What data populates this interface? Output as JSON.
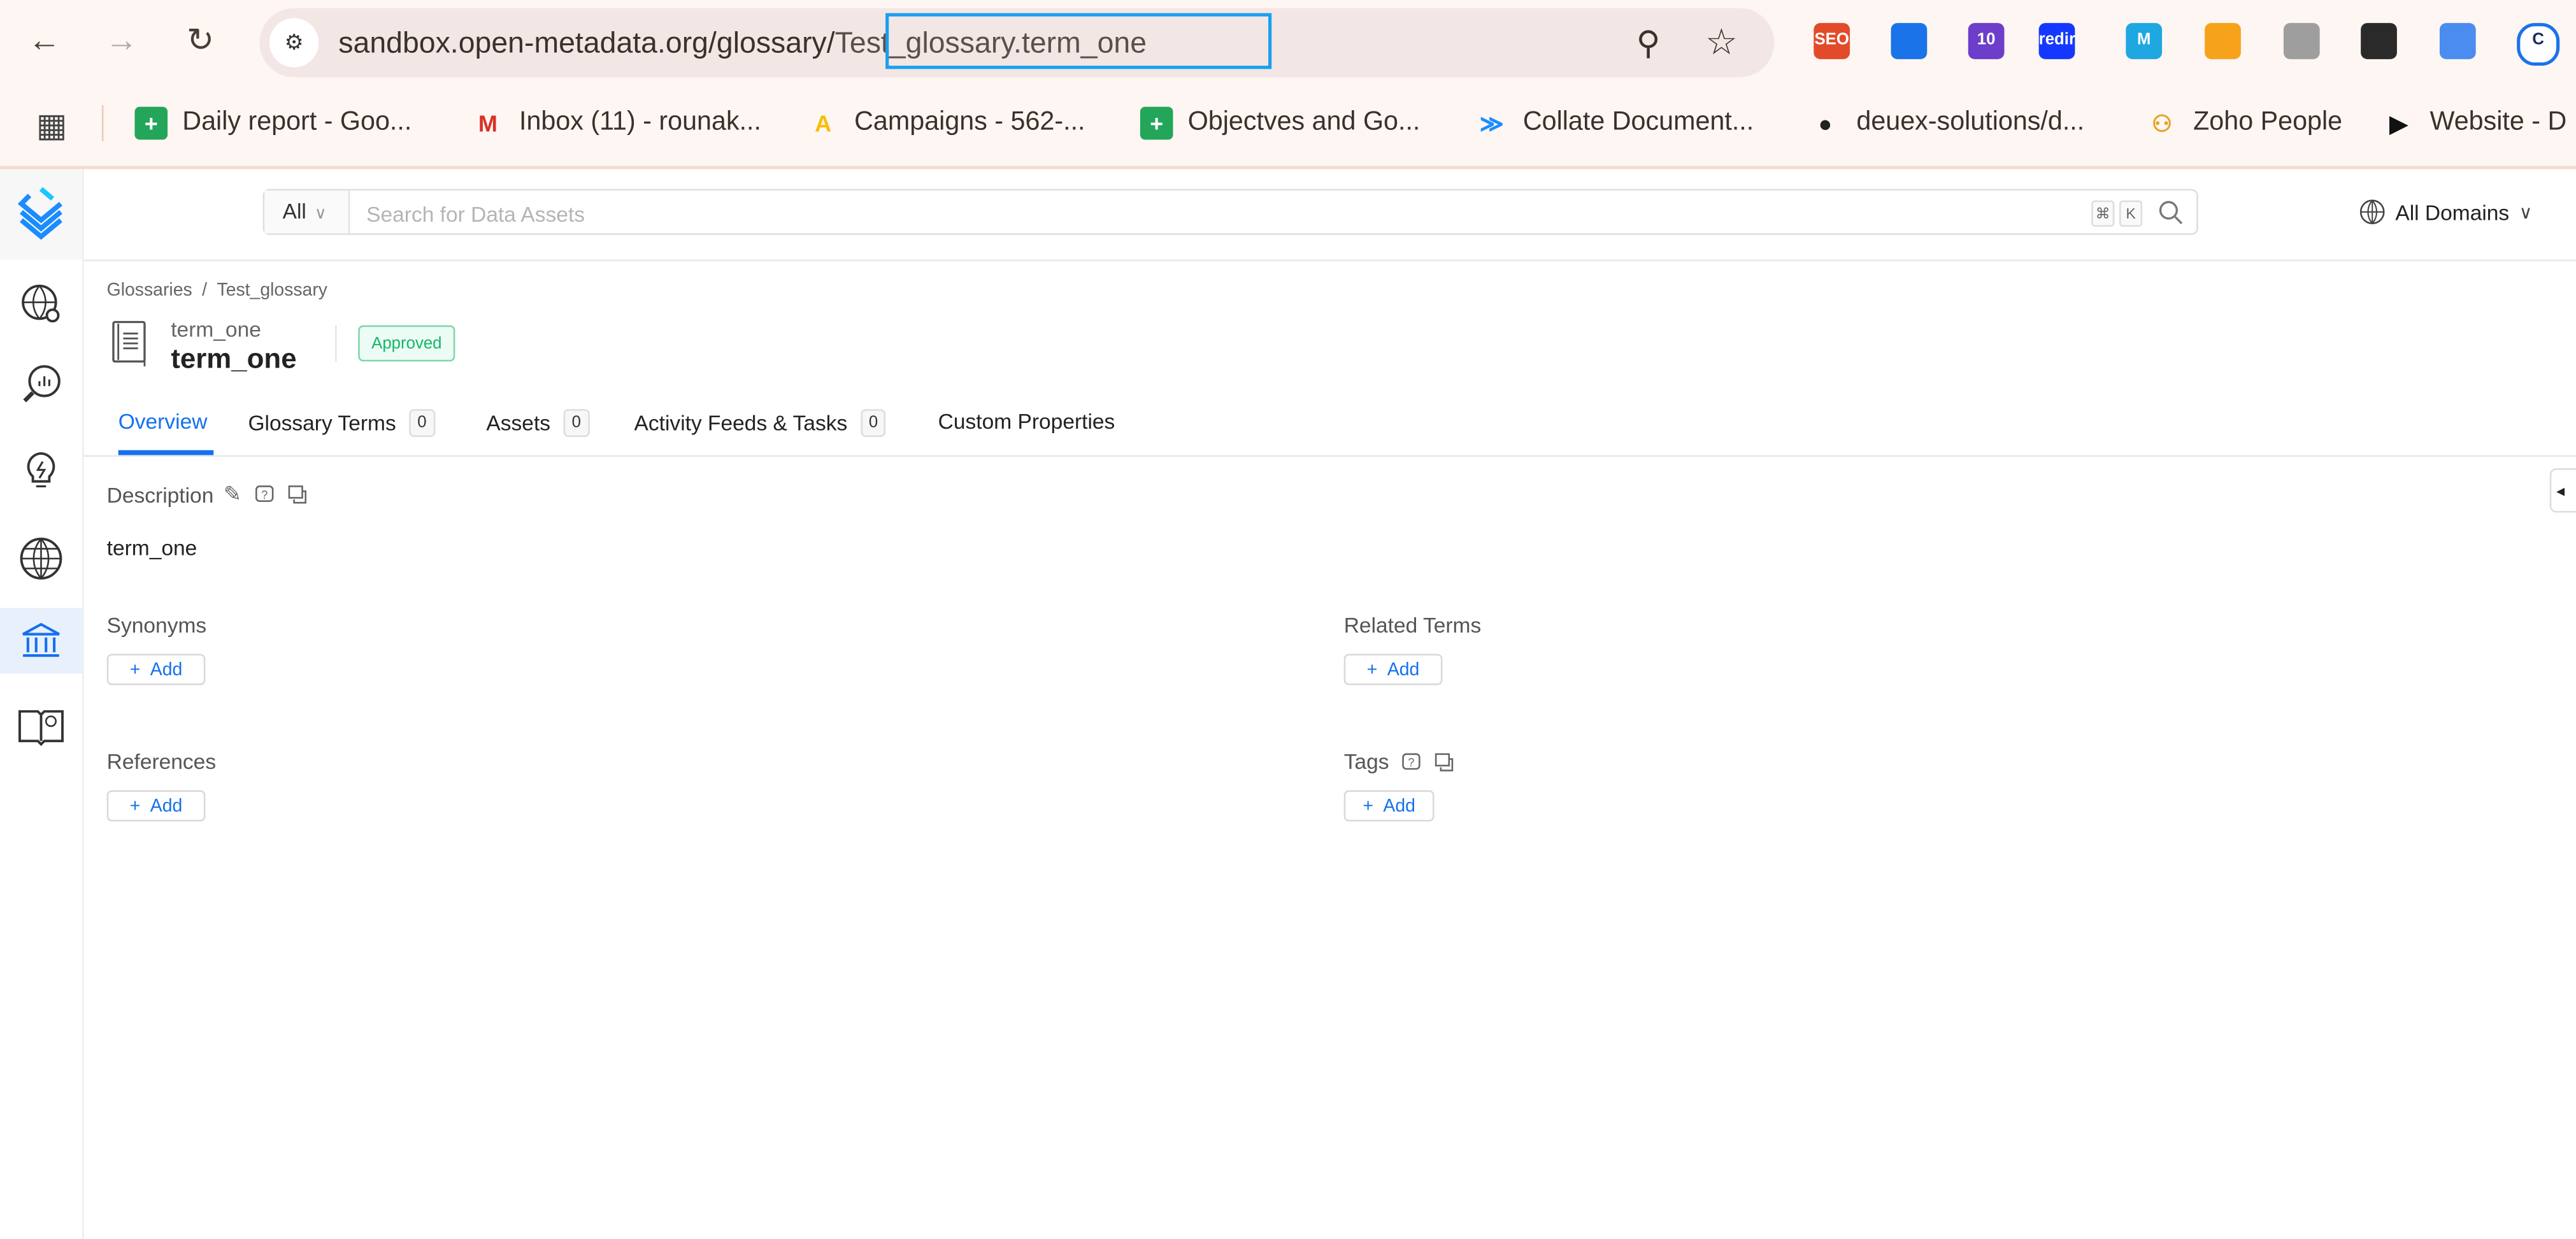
{
  "browser": {
    "url_host": "sandbox.open-metadata.org/glossary/",
    "url_path": "Test_glossary.term_one",
    "extensions": [
      {
        "name": "seo-extension",
        "label": "SEO",
        "color": "#e24b2a"
      },
      {
        "name": "tag-extension",
        "label": "",
        "color": "#1a73e8"
      },
      {
        "name": "badge-10-extension",
        "label": "10",
        "color": "#6c3ec9"
      },
      {
        "name": "redir-extension",
        "label": "redir",
        "color": "#1438ff"
      },
      {
        "name": "m-extension",
        "label": "M",
        "color": "#1ea7e1"
      },
      {
        "name": "orange-extension",
        "label": "",
        "color": "#f7a21b"
      },
      {
        "name": "avatar-extension",
        "label": "",
        "color": "#9e9e9e"
      },
      {
        "name": "dark-extension",
        "label": "",
        "color": "#2a2a2a"
      },
      {
        "name": "blue-tag-extension",
        "label": "",
        "color": "#4a8cf0"
      },
      {
        "name": "c-extension",
        "label": "C",
        "color": "#1a73e8"
      }
    ],
    "bookmarks": [
      {
        "label": "Daily report - Goo...",
        "icon": "sheets-icon",
        "color": "#23a55a"
      },
      {
        "label": "Inbox (11) - rounak...",
        "icon": "gmail-icon",
        "color": "#d93025"
      },
      {
        "label": "Campaigns - 562-...",
        "icon": "google-ads-icon",
        "color": "#fbbc04"
      },
      {
        "label": "Objectves and Go...",
        "icon": "sheets-icon",
        "color": "#23a55a"
      },
      {
        "label": "Collate Document...",
        "icon": "collate-icon",
        "color": "#1a8cff"
      },
      {
        "label": "deuex-solutions/d...",
        "icon": "github-icon",
        "color": "#222222"
      },
      {
        "label": "Zoho People",
        "icon": "zoho-icon",
        "color": "#e4a524"
      },
      {
        "label": "Website - D",
        "icon": "play-icon",
        "color": "#111111"
      }
    ]
  },
  "header": {
    "search_category": "All",
    "search_placeholder": "Search for Data Assets",
    "shortcut_cmd": "⌘",
    "shortcut_key": "K",
    "domains_label": "All Domains"
  },
  "breadcrumb": [
    "Glossaries",
    "Test_glossary"
  ],
  "term": {
    "display_small": "term_one",
    "display_name": "term_one",
    "status": "Approved",
    "status_color": "#12b76a"
  },
  "tabs": [
    {
      "label": "Overview",
      "count": null
    },
    {
      "label": "Glossary Terms",
      "count": "0"
    },
    {
      "label": "Assets",
      "count": "0"
    },
    {
      "label": "Activity Feeds & Tasks",
      "count": "0"
    },
    {
      "label": "Custom Properties",
      "count": null
    }
  ],
  "overview": {
    "description_label": "Description",
    "description_text": "term_one",
    "synonyms_label": "Synonyms",
    "related_terms_label": "Related Terms",
    "references_label": "References",
    "tags_label": "Tags",
    "add_label": "Add"
  },
  "accent_color": "#1570ef"
}
